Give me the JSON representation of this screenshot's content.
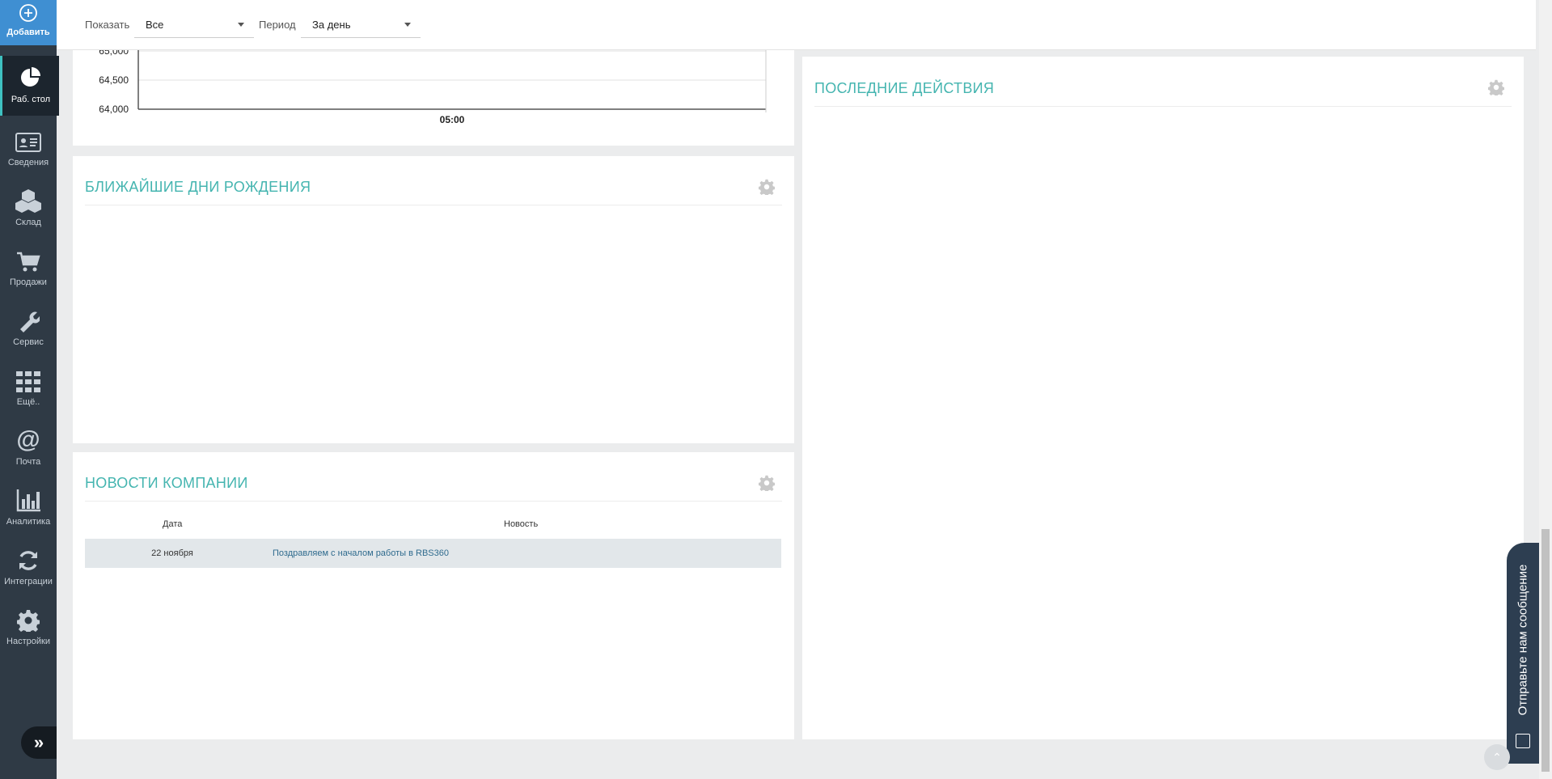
{
  "sidebar": {
    "add": {
      "label": "Добавить",
      "icon": "plus-circle-icon"
    },
    "items": [
      {
        "label": "Раб. стол",
        "icon": "pie-chart-icon",
        "active": true
      },
      {
        "label": "Сведения",
        "icon": "id-card-icon"
      },
      {
        "label": "Склад",
        "icon": "boxes-icon"
      },
      {
        "label": "Продажи",
        "icon": "cart-icon"
      },
      {
        "label": "Сервис",
        "icon": "wrench-icon"
      },
      {
        "label": "Ещё..",
        "icon": "grid-icon"
      },
      {
        "label": "Почта",
        "icon": "at-icon"
      },
      {
        "label": "Аналитика",
        "icon": "bar-chart-icon"
      },
      {
        "label": "Интеграции",
        "icon": "sync-icon"
      },
      {
        "label": "Настройки",
        "icon": "gear-icon"
      }
    ],
    "collapse_icon": "double-chevron-right-icon"
  },
  "filters": {
    "show_label": "Показать",
    "show_value": "Все",
    "period_label": "Период",
    "period_value": "За день"
  },
  "chart_data": {
    "type": "line",
    "x": [
      "05:00"
    ],
    "y_ticks": [
      65000,
      64500,
      64000
    ],
    "y_tick_labels": [
      "65,000",
      "64,500",
      "64,000"
    ],
    "series": [],
    "grid": true
  },
  "birthdays": {
    "title": "БЛИЖАЙШИЕ ДНИ РОЖДЕНИЯ"
  },
  "news": {
    "title": "НОВОСТИ КОМПАНИИ",
    "columns": [
      "Дата",
      "Новость"
    ],
    "rows": [
      {
        "date": "22 ноября",
        "text": "Поздравляем с началом работы в RBS360"
      }
    ]
  },
  "recent": {
    "title": "ПОСЛЕДНИЕ ДЕЙСТВИЯ"
  },
  "feedback": {
    "label": "Отправьте нам сообщение"
  },
  "colors": {
    "accent": "#45b5b0",
    "sidebar": "#2f3a45",
    "add_button": "#3f8fd2"
  }
}
